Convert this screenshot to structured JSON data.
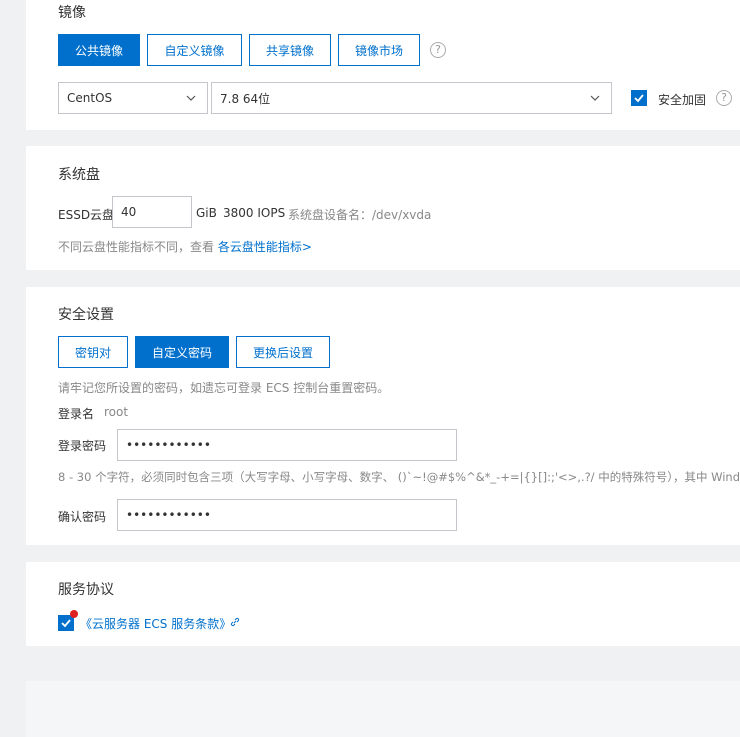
{
  "image_section": {
    "title": "镜像",
    "tabs": [
      {
        "label": "公共镜像",
        "active": true
      },
      {
        "label": "自定义镜像",
        "active": false
      },
      {
        "label": "共享镜像",
        "active": false
      },
      {
        "label": "镜像市场",
        "active": false
      }
    ],
    "os_select": "CentOS",
    "version_select": "7.8 64位",
    "security_hardening_label": "安全加固",
    "security_hardening_checked": true
  },
  "disk_section": {
    "title": "系统盘",
    "disk_type": "ESSD云盘",
    "size_value": "40",
    "size_unit": "GiB",
    "iops": "3800 IOPS",
    "device_name": "系统盘设备名：/dev/xvda",
    "hint": "不同云盘性能指标不同，查看",
    "hint_link": "各云盘性能指标>"
  },
  "security_section": {
    "title": "安全设置",
    "tabs": [
      {
        "label": "密钥对",
        "active": false
      },
      {
        "label": "自定义密码",
        "active": true
      },
      {
        "label": "更换后设置",
        "active": false
      }
    ],
    "notice": "请牢记您所设置的密码，如遗忘可登录 ECS 控制台重置密码。",
    "login_name_label": "登录名",
    "login_name_value": "root",
    "password_label": "登录密码",
    "password_value": "••••••••••••",
    "password_rule": "8 - 30 个字符，必须同时包含三项（大写字母、小写字母、数字、 ()`~!@#$%^&*_-+=|{}[]:;'<>,.?/ 中的特殊符号），其中 Windows",
    "confirm_label": "确认密码",
    "confirm_value": "••••••••••••"
  },
  "agreement_section": {
    "title": "服务协议",
    "agreement_link": "《云服务器 ECS 服务条款》",
    "checked": true
  },
  "colors": {
    "accent": "#0070cc",
    "background": "#f0f1f3",
    "badge": "#e02020"
  }
}
